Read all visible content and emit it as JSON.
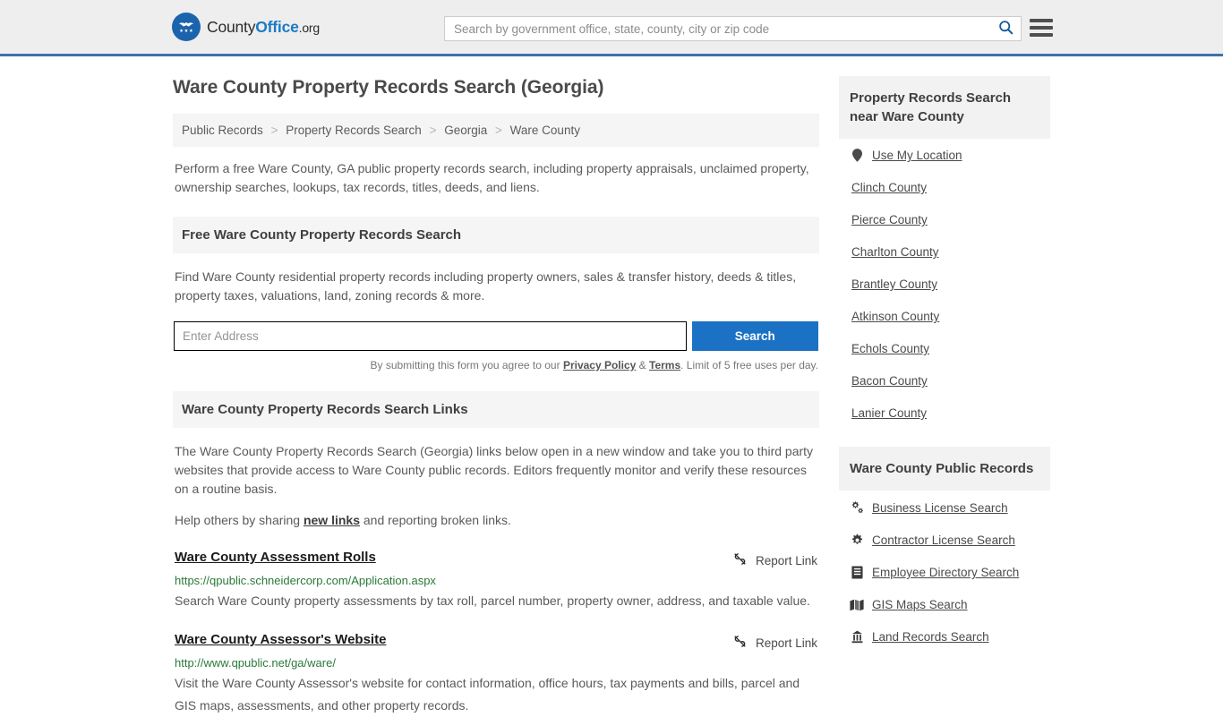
{
  "header": {
    "logo": {
      "icon": "eagle-seal-icon",
      "text_county": "County",
      "text_office": "Office",
      "text_org": ".org"
    },
    "search": {
      "placeholder": "Search by government office, state, county, city or zip code",
      "value": "",
      "icon": "search-icon"
    },
    "menu_icon": "hamburger-menu-icon"
  },
  "main": {
    "title": "Ware County Property Records Search (Georgia)",
    "breadcrumb": {
      "separator": ">",
      "items": [
        {
          "label": "Public Records"
        },
        {
          "label": "Property Records Search"
        },
        {
          "label": "Georgia"
        },
        {
          "label": "Ware County"
        }
      ]
    },
    "intro": "Perform a free Ware County, GA public property records search, including property appraisals, unclaimed property, ownership searches, lookups, tax records, titles, deeds, and liens.",
    "free_search": {
      "heading": "Free Ware County Property Records Search",
      "description": "Find Ware County residential property records including property owners, sales & transfer history, deeds & titles, property taxes, valuations, land, zoning records & more.",
      "input_placeholder": "Enter Address",
      "input_value": "",
      "button_label": "Search",
      "disclaimer_prefix": "By submitting this form you agree to our ",
      "privacy_label": "Privacy Policy",
      "disclaimer_amp": " & ",
      "terms_label": "Terms",
      "disclaimer_suffix": ". Limit of 5 free uses per day."
    },
    "links_section": {
      "heading": "Ware County Property Records Search Links",
      "paragraph": "The Ware County Property Records Search (Georgia) links below open in a new window and take you to third party websites that provide access to Ware County public records. Editors frequently monitor and verify these resources on a routine basis.",
      "help_prefix": "Help others by sharing ",
      "help_link": "new links",
      "help_suffix": " and reporting broken links.",
      "report_label": "Report Link",
      "report_icon": "broken-link-icon",
      "results": [
        {
          "title": "Ware County Assessment Rolls",
          "url": "https://qpublic.schneidercorp.com/Application.aspx",
          "description": "Search Ware County property assessments by tax roll, parcel number, property owner, address, and taxable value."
        },
        {
          "title": "Ware County Assessor's Website",
          "url": "http://www.qpublic.net/ga/ware/",
          "description": "Visit the Ware County Assessor's website for contact information, office hours, tax payments and bills, parcel and GIS maps, assessments, and other property records."
        }
      ]
    }
  },
  "sidebar": {
    "nearby": {
      "heading": "Property Records Search near Ware County",
      "use_my_location": {
        "label": "Use My Location",
        "icon": "map-pin-icon"
      },
      "counties": [
        {
          "label": "Clinch County"
        },
        {
          "label": "Pierce County"
        },
        {
          "label": "Charlton County"
        },
        {
          "label": "Brantley County"
        },
        {
          "label": "Atkinson County"
        },
        {
          "label": "Echols County"
        },
        {
          "label": "Bacon County"
        },
        {
          "label": "Lanier County"
        }
      ]
    },
    "public_records": {
      "heading": "Ware County Public Records",
      "items": [
        {
          "label": "Business License Search",
          "icon": "cogs-icon"
        },
        {
          "label": "Contractor License Search",
          "icon": "gear-icon"
        },
        {
          "label": "Employee Directory Search",
          "icon": "id-card-icon"
        },
        {
          "label": "GIS Maps Search",
          "icon": "map-icon"
        },
        {
          "label": "Land Records Search",
          "icon": "landmark-icon"
        }
      ]
    }
  },
  "colors": {
    "brand_blue": "#1b7bc6",
    "header_border": "#3b73a8",
    "button_blue": "#1b72c4",
    "url_green": "#2a7a39",
    "panel_gray": "#f5f5f5"
  }
}
